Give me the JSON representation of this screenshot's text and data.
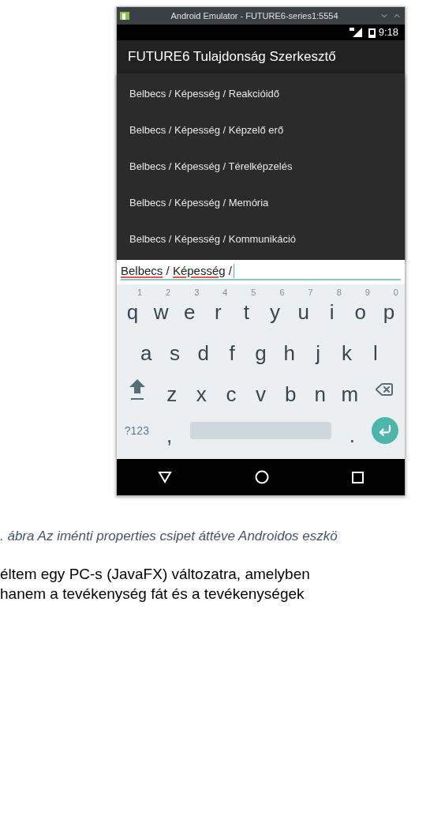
{
  "emulator": {
    "title": "Android Emulator - FUTURE6-series1:5554",
    "status_bar": {
      "time": "9:18"
    },
    "app_bar": {
      "title": "FUTURE6 Tulajdonság Szerkesztő"
    },
    "suggestions": [
      "Belbecs / Képesség / Reakcióidő",
      "Belbecs / Képesség / Képzelő erő",
      "Belbecs / Képesség / Térelképzelés",
      "Belbecs / Képesség / Memória",
      "Belbecs / Képesség / Kommunikáció"
    ],
    "input": {
      "value": [
        {
          "text": "Belbecs",
          "misspelled": true
        },
        {
          "text": " / ",
          "misspelled": false
        },
        {
          "text": "Képesség",
          "misspelled": true
        },
        {
          "text": " /",
          "misspelled": false
        }
      ]
    },
    "keyboard": {
      "rows": [
        [
          {
            "kind": "letter",
            "label": "q",
            "hint": "1"
          },
          {
            "kind": "letter",
            "label": "w",
            "hint": "2"
          },
          {
            "kind": "letter",
            "label": "e",
            "hint": "3"
          },
          {
            "kind": "letter",
            "label": "r",
            "hint": "4"
          },
          {
            "kind": "letter",
            "label": "t",
            "hint": "5"
          },
          {
            "kind": "letter",
            "label": "y",
            "hint": "6"
          },
          {
            "kind": "letter",
            "label": "u",
            "hint": "7"
          },
          {
            "kind": "letter",
            "label": "i",
            "hint": "8"
          },
          {
            "kind": "letter",
            "label": "o",
            "hint": "9"
          },
          {
            "kind": "letter",
            "label": "p",
            "hint": "0"
          }
        ],
        [
          {
            "kind": "letter",
            "label": "a"
          },
          {
            "kind": "letter",
            "label": "s"
          },
          {
            "kind": "letter",
            "label": "d"
          },
          {
            "kind": "letter",
            "label": "f"
          },
          {
            "kind": "letter",
            "label": "g"
          },
          {
            "kind": "letter",
            "label": "h"
          },
          {
            "kind": "letter",
            "label": "j"
          },
          {
            "kind": "letter",
            "label": "k"
          },
          {
            "kind": "letter",
            "label": "l"
          }
        ],
        [
          {
            "kind": "shift"
          },
          {
            "kind": "letter",
            "label": "z"
          },
          {
            "kind": "letter",
            "label": "x"
          },
          {
            "kind": "letter",
            "label": "c"
          },
          {
            "kind": "letter",
            "label": "v"
          },
          {
            "kind": "letter",
            "label": "b"
          },
          {
            "kind": "letter",
            "label": "n"
          },
          {
            "kind": "letter",
            "label": "m"
          },
          {
            "kind": "backspace"
          }
        ],
        [
          {
            "kind": "mode",
            "label": "?123"
          },
          {
            "kind": "letter",
            "label": ","
          },
          {
            "kind": "space"
          },
          {
            "kind": "letter",
            "label": "."
          },
          {
            "kind": "enter"
          }
        ]
      ]
    }
  },
  "caption": ". ábra Az iménti properties csipet áttéve Androidos eszkö",
  "body_lines": [
    "éltem egy PC-s (JavaFX) változatra, amelyben",
    "hanem a tevékenység fát és a tevékenységek"
  ]
}
